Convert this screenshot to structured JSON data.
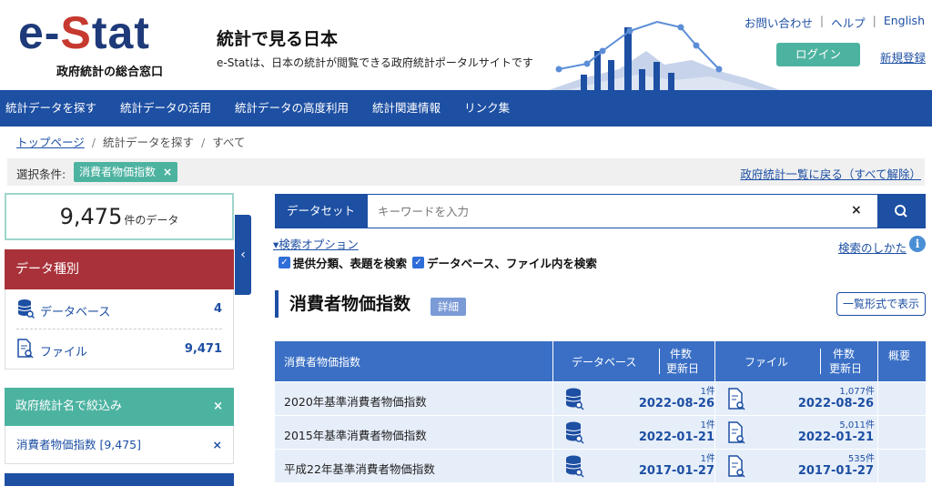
{
  "header": {
    "logo_prefix": "e-",
    "logo_s": "S",
    "logo_rest": "tat",
    "logo_sub": "政府統計の総合窓口",
    "site_title": "統計で見る日本",
    "site_desc": "e-Statは、日本の統計が閲覧できる政府統計ポータルサイトです",
    "links": [
      "お問い合わせ",
      "ヘルプ",
      "English"
    ],
    "login": "ログイン",
    "register": "新規登録"
  },
  "nav": [
    "統計データを探す",
    "統計データの活用",
    "統計データの高度利用",
    "統計関連情報",
    "リンク集"
  ],
  "breadcrumb": {
    "home": "トップページ",
    "level2": "統計データを探す",
    "level3": "すべて"
  },
  "filter": {
    "label": "選択条件:",
    "chip": "消費者物価指数",
    "chip_x": "×",
    "back": "政府統計一覧に戻る（すべて解除）"
  },
  "count": {
    "number": "9,475",
    "unit": "件のデータ"
  },
  "datatype": {
    "title": "データ種別",
    "items": [
      {
        "label": "データベース",
        "count": "4"
      },
      {
        "label": "ファイル",
        "count": "9,471"
      }
    ]
  },
  "narrow": {
    "title": "政府統計名で絞込み",
    "x": "×",
    "item": "消費者物価指数 [9,475]",
    "item_x": "×"
  },
  "search": {
    "type": "データセット",
    "chevron": "⌄",
    "placeholder": "キーワードを入力",
    "clear": "×"
  },
  "options": {
    "toggle": "▾検索オプション",
    "how": "検索のしかた",
    "info": "i",
    "check1": "提供分類、表題を検索",
    "check2": "データベース、ファイル内を検索"
  },
  "section": {
    "title": "消費者物価指数",
    "badge": "詳細",
    "list_btn": "一覧形式で表示"
  },
  "table": {
    "headers": {
      "name": "消費者物価指数",
      "database": "データベース",
      "count_line1": "件数",
      "count_line2": "更新日",
      "file": "ファイル",
      "summary": "概要"
    },
    "rows": [
      {
        "name": "2020年基準消費者物価指数",
        "db_count": "1",
        "db_date": "2022-08-26",
        "file_count": "1,077",
        "file_date": "2022-08-26"
      },
      {
        "name": "2015年基準消費者物価指数",
        "db_count": "1",
        "db_date": "2022-01-21",
        "file_count": "5,011",
        "file_date": "2022-01-21"
      },
      {
        "name": "平成22年基準消費者物価指数",
        "db_count": "1",
        "db_date": "2017-01-27",
        "file_count": "535",
        "file_date": "2017-01-27"
      }
    ],
    "unit": "件"
  },
  "colors": {
    "brand_blue": "#1d4fa3",
    "brand_red": "#c6392f",
    "teal": "#4db3a1",
    "maroon": "#a9323a"
  },
  "icons": [
    "database-icon",
    "file-search-icon",
    "search-icon",
    "chevron-left-icon",
    "info-icon",
    "close-icon"
  ]
}
